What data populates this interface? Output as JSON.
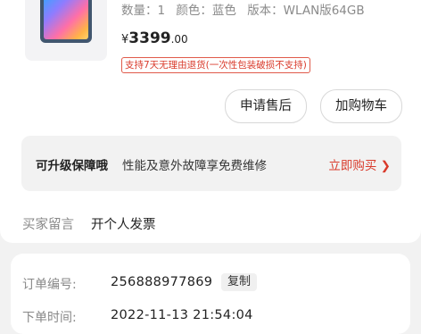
{
  "product": {
    "image_icon": "tablet-product-image",
    "spec": {
      "quantity": "数量：1",
      "color": "颜色：蓝色",
      "version": "版本：WLAN版64GB"
    },
    "price": {
      "currency": "¥",
      "integer": "3399",
      "decimal": ".00"
    },
    "return_tag": "支持7天无理由退货(一次性包装破损不支持)"
  },
  "actions": {
    "after_sale": "申请售后",
    "add_to_cart": "加购物车"
  },
  "protection": {
    "title": "可升级保障哦",
    "desc": "性能及意外故障享免费维修",
    "buy": "立即购买 ❯",
    "buy_color": "#d93a2b"
  },
  "buyer_message": {
    "label": "买家留言",
    "value": "开个人发票"
  },
  "order": {
    "number_label": "订单编号:",
    "number_value": "256888977869",
    "copy_label": "复制",
    "time_label": "下单时间:",
    "time_value": "2022-11-13 21:54:04"
  }
}
